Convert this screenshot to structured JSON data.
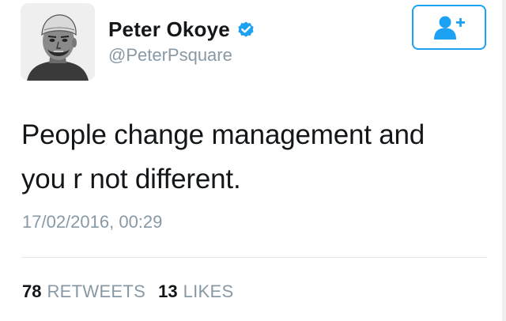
{
  "tweet": {
    "author": {
      "display_name": "Peter Okoye",
      "handle": "@PeterPsquare",
      "verified": true,
      "avatar_icon": "avatar-portrait-sketch"
    },
    "follow_button": {
      "icon": "add-user-icon"
    },
    "text_lines": [
      "People change management and",
      "you r not different."
    ],
    "timestamp": "17/02/2016, 00:29",
    "stats": {
      "retweets_count": "78",
      "retweets_label": "RETWEETS",
      "likes_count": "13",
      "likes_label": "LIKES"
    }
  },
  "colors": {
    "brand_blue": "#1da1f2",
    "text_primary": "#14171a",
    "text_secondary": "#8899a6",
    "divider": "#e1e8ed"
  }
}
